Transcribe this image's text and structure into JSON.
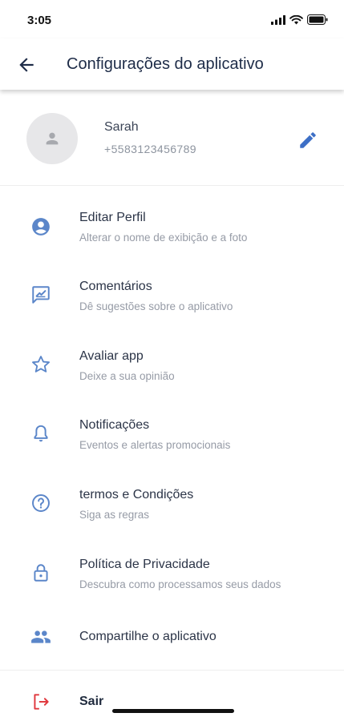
{
  "status_bar": {
    "time": "3:05"
  },
  "app_bar": {
    "title": "Configurações do aplicativo"
  },
  "profile": {
    "name": "Sarah",
    "phone": "+5583123456789"
  },
  "menu": {
    "items": [
      {
        "title": "Editar Perfil",
        "subtitle": "Alterar o nome de exibição e a foto",
        "icon": "account-circle-icon"
      },
      {
        "title": "Comentários",
        "subtitle": "Dê sugestões sobre o aplicativo",
        "icon": "feedback-icon"
      },
      {
        "title": "Avaliar app",
        "subtitle": "Deixe a sua opinião",
        "icon": "star-icon"
      },
      {
        "title": "Notificações",
        "subtitle": "Eventos e alertas promocionais",
        "icon": "bell-icon"
      },
      {
        "title": "termos e Condições",
        "subtitle": "Siga as regras",
        "icon": "help-circle-icon"
      },
      {
        "title": "Política de Privacidade",
        "subtitle": "Descubra como processamos seus dados",
        "icon": "lock-icon"
      },
      {
        "title": "Compartilhe o aplicativo",
        "subtitle": "",
        "icon": "people-icon"
      }
    ]
  },
  "logout": {
    "label": "Sair",
    "icon": "logout-icon"
  },
  "colors": {
    "accent": "#3d6fc6",
    "icon_blue": "#5b86c9",
    "logout_red": "#e0383e",
    "title_text": "#1e2c48",
    "subtitle_text": "#969ba6"
  }
}
